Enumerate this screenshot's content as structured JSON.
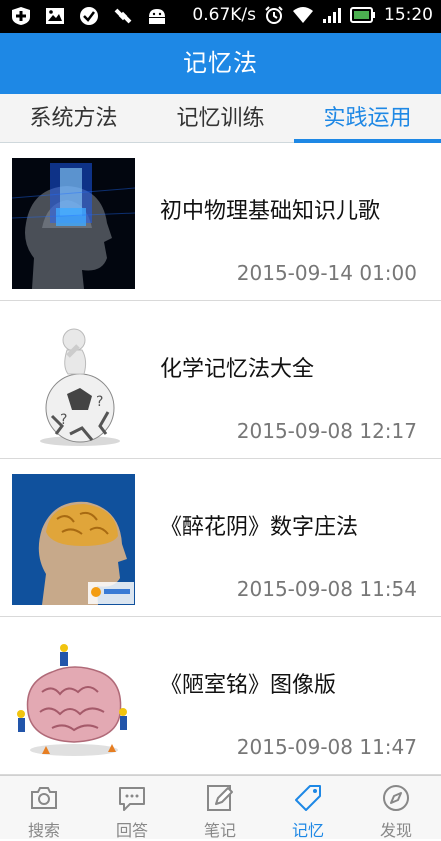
{
  "status_bar": {
    "speed": "0.67K/s",
    "time": "15:20",
    "left_icons": [
      "medical-plus-icon",
      "image-icon",
      "check-circle-icon",
      "satellite-icon",
      "android-icon"
    ],
    "right_icons": [
      "alarm-icon",
      "wifi-icon",
      "signal-icon",
      "battery-icon"
    ]
  },
  "header": {
    "title": "记忆法"
  },
  "tabs": [
    {
      "label": "系统方法",
      "active": false
    },
    {
      "label": "记忆训练",
      "active": false
    },
    {
      "label": "实践运用",
      "active": true
    }
  ],
  "articles": [
    {
      "title": "初中物理基础知识儿歌",
      "date": "2015-09-14 01:00",
      "thumb": "digital-head-image"
    },
    {
      "title": "化学记忆法大全",
      "date": "2015-09-08 12:17",
      "thumb": "figure-on-ball-image"
    },
    {
      "title": "《醉花阴》数字庄法",
      "date": "2015-09-08 11:54",
      "thumb": "brain-xray-image"
    },
    {
      "title": "《陋室铭》图像版",
      "date": "2015-09-08 11:47",
      "thumb": "brain-workers-image"
    }
  ],
  "bottom_nav": [
    {
      "label": "搜索",
      "icon": "camera-icon",
      "active": false
    },
    {
      "label": "回答",
      "icon": "chat-bubble-icon",
      "active": false
    },
    {
      "label": "笔记",
      "icon": "pencil-note-icon",
      "active": false
    },
    {
      "label": "记忆",
      "icon": "tag-icon",
      "active": true
    },
    {
      "label": "发现",
      "icon": "compass-icon",
      "active": false
    }
  ],
  "colors": {
    "accent": "#1e88e5",
    "status_bar": "#000000",
    "battery": "#4caf50"
  }
}
